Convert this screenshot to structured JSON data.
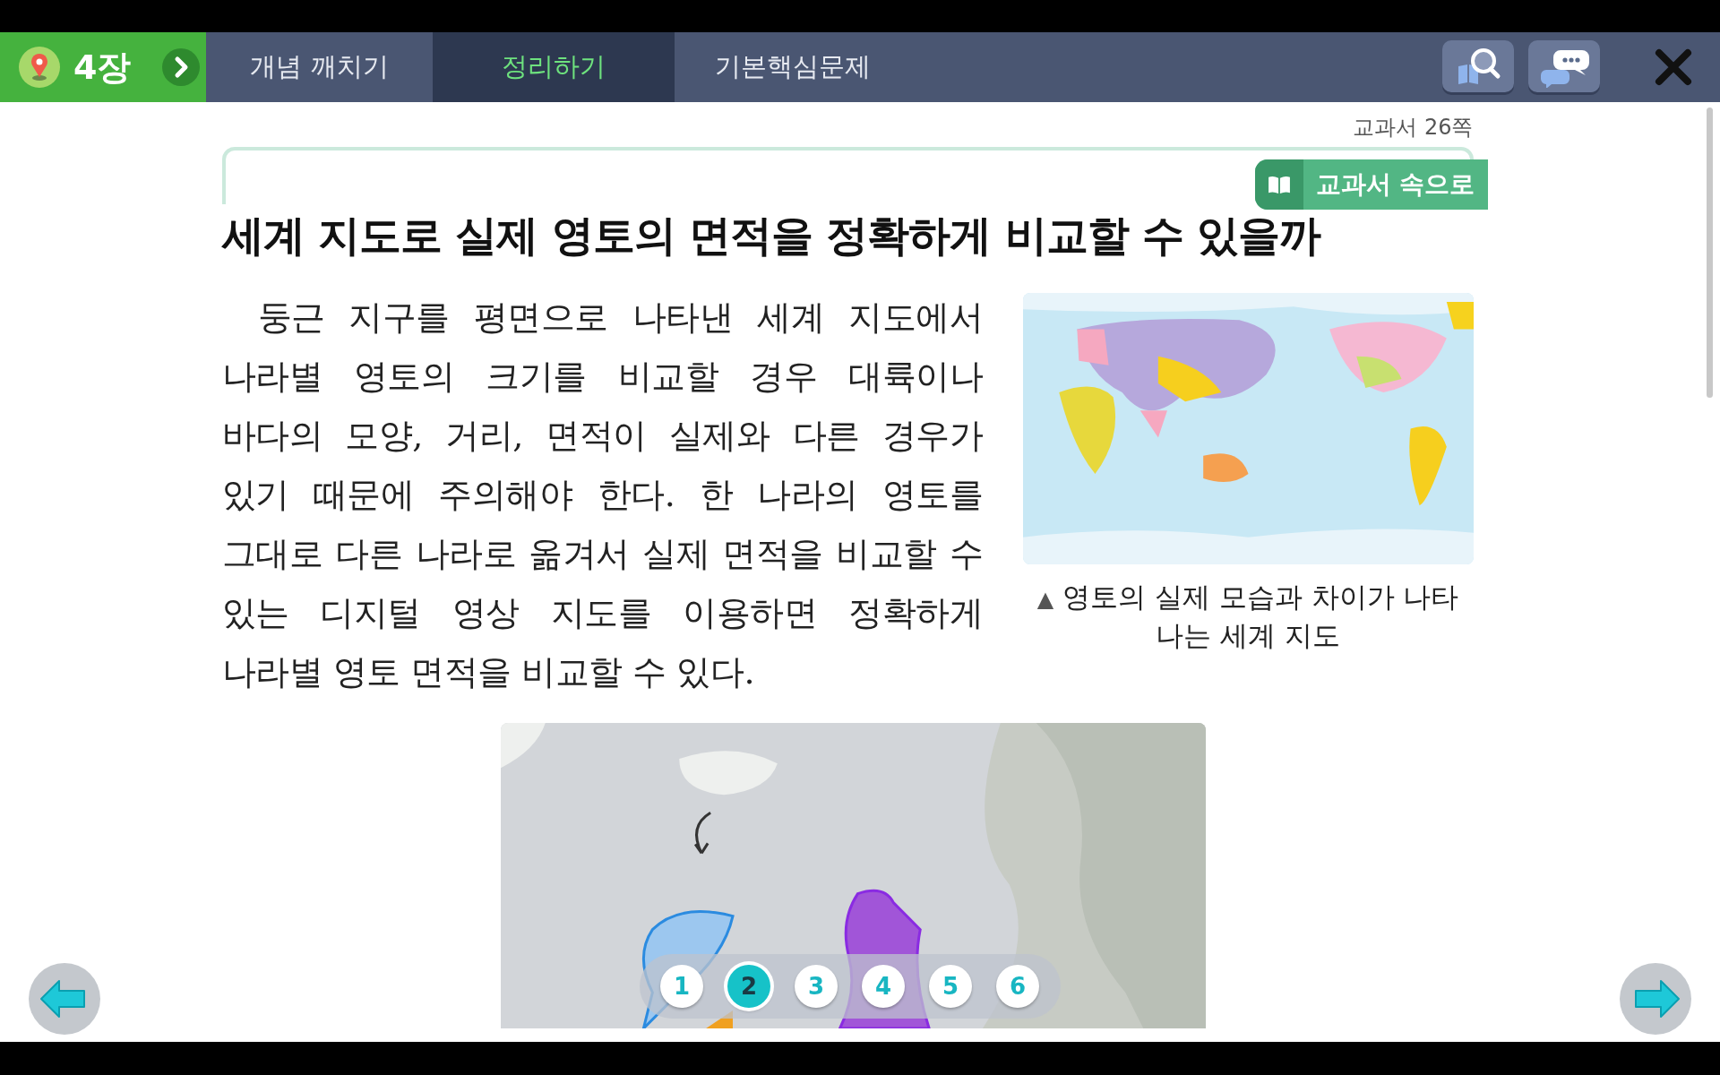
{
  "chapter": {
    "label": "4장"
  },
  "tabs": [
    {
      "label": "개념 깨치기",
      "selected": false
    },
    {
      "label": "정리하기",
      "selected": true
    },
    {
      "label": "기본핵심문제",
      "selected": false
    }
  ],
  "page_ref": "교과서 26쪽",
  "section_tag": "교과서 속으로",
  "title": "세계 지도로 실제 영토의 면적을 정확하게 비교할 수 있을까",
  "paragraph": "둥근 지구를 평면으로 나타낸 세계 지도에서 나라별 영토의 크기를 비교할 경우 대륙이나 바다의 모양, 거리, 면적이 실제와 다른 경우가 있기 때문에 주의해야 한다. 한 나라의 영토를 그대로 다른 나라로 옮겨서 실제 면적을 비교할 수 있는 디지털 영상 지도를 이용하면 정확하게 나라별 영토 면적을 비교할 수 있다.",
  "figure": {
    "kind": "picture",
    "caption_mark": "▲",
    "caption": "영토의 실제 모습과 차이가 나타나는 세계 지도"
  },
  "pages": [
    {
      "label": "1",
      "selected": false
    },
    {
      "label": "2",
      "selected": true
    },
    {
      "label": "3",
      "selected": false
    },
    {
      "label": "4",
      "selected": false
    },
    {
      "label": "5",
      "selected": false
    },
    {
      "label": "6",
      "selected": false
    }
  ]
}
